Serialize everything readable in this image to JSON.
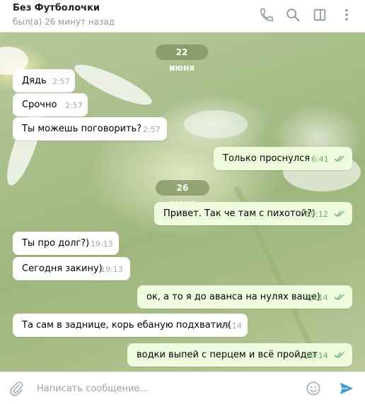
{
  "header": {
    "title": "Без Футболочки",
    "status": "был(а) 26 минут назад",
    "icons": [
      "phone-icon",
      "search-icon",
      "sidebar-icon",
      "more-icon"
    ]
  },
  "dates": [
    "22 июня",
    "26 июня"
  ],
  "messages": [
    {
      "dir": "in",
      "text": "Дядь",
      "time": "2:57"
    },
    {
      "dir": "in",
      "text": "Срочно",
      "time": "2:57"
    },
    {
      "dir": "in",
      "text": "Ты можешь поговорить?",
      "time": "2:57"
    },
    {
      "dir": "out",
      "text": "Только проснулся",
      "time": "6:41",
      "read": true
    },
    {
      "dir": "out",
      "text": "Привет. Так че там с пихотой?)",
      "time": "19:12",
      "read": true
    },
    {
      "dir": "in",
      "text": "Ты про долг?)",
      "time": "19:13"
    },
    {
      "dir": "in",
      "text": "Сегодня закину)",
      "time": "19:13"
    },
    {
      "dir": "out",
      "text": "ок, а то я до аванса на нулях ваще)",
      "time": "19:14",
      "read": true
    },
    {
      "dir": "in",
      "text": "Та  сам в заднице, корь ебаную подхватил(",
      "time": "19:14"
    },
    {
      "dir": "out",
      "text": "водки выпей с перцем и всё пройдет",
      "time": "19:14",
      "read": true
    }
  ],
  "composer": {
    "placeholder": "Написать сообщение..."
  },
  "colors": {
    "accent": "#3a9be0",
    "incoming_bubble": "#ffffff",
    "outgoing_bubble": "#effdde",
    "read_check": "#6cb062"
  }
}
